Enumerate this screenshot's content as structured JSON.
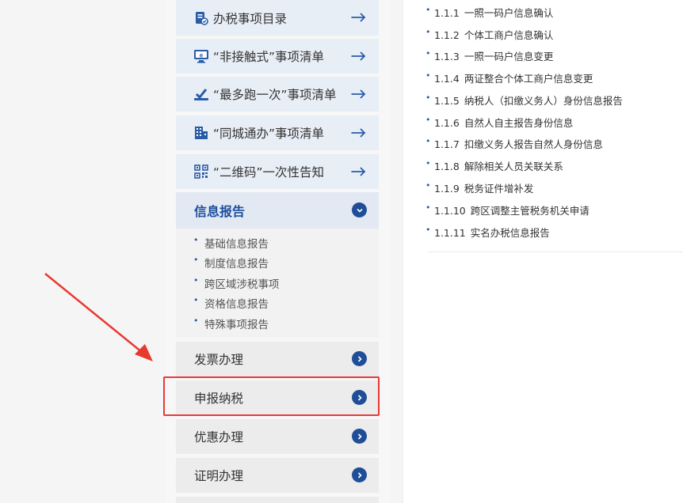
{
  "services": [
    {
      "label": "办税事项目录",
      "icon": "tax-list-icon"
    },
    {
      "label": "“非接触式”事项清单",
      "icon": "computer-icon"
    },
    {
      "label": "“最多跑一次”事项清单",
      "icon": "vote-check-icon"
    },
    {
      "label": "“同城通办”事项清单",
      "icon": "building-icon"
    },
    {
      "label": "“二维码”一次性告知",
      "icon": "qr-code-icon"
    }
  ],
  "section": {
    "title": "信息报告",
    "items": [
      "基础信息报告",
      "制度信息报告",
      "跨区域涉税事项",
      "资格信息报告",
      "特殊事项报告"
    ]
  },
  "categories": [
    {
      "label": "发票办理"
    },
    {
      "label": "申报纳税"
    },
    {
      "label": "优惠办理"
    },
    {
      "label": "证明办理"
    }
  ],
  "content_items": [
    {
      "num": "1.1.1",
      "text": "一照一码户信息确认"
    },
    {
      "num": "1.1.2",
      "text": "个体工商户信息确认"
    },
    {
      "num": "1.1.3",
      "text": "一照一码户信息变更"
    },
    {
      "num": "1.1.4",
      "text": "两证整合个体工商户信息变更"
    },
    {
      "num": "1.1.5",
      "text": "纳税人（扣缴义务人）身份信息报告"
    },
    {
      "num": "1.1.6",
      "text": "自然人自主报告身份信息"
    },
    {
      "num": "1.1.7",
      "text": "扣缴义务人报告自然人身份信息"
    },
    {
      "num": "1.1.8",
      "text": "解除相关人员关联关系"
    },
    {
      "num": "1.1.9",
      "text": "税务证件增补发"
    },
    {
      "num": "1.1.10",
      "text": "跨区调整主管税务机关申请"
    },
    {
      "num": "1.1.11",
      "text": "实名办税信息报告"
    }
  ],
  "colors": {
    "accent": "#1f4d98",
    "highlight": "#e63a3a",
    "arrow": "#e8392f"
  }
}
